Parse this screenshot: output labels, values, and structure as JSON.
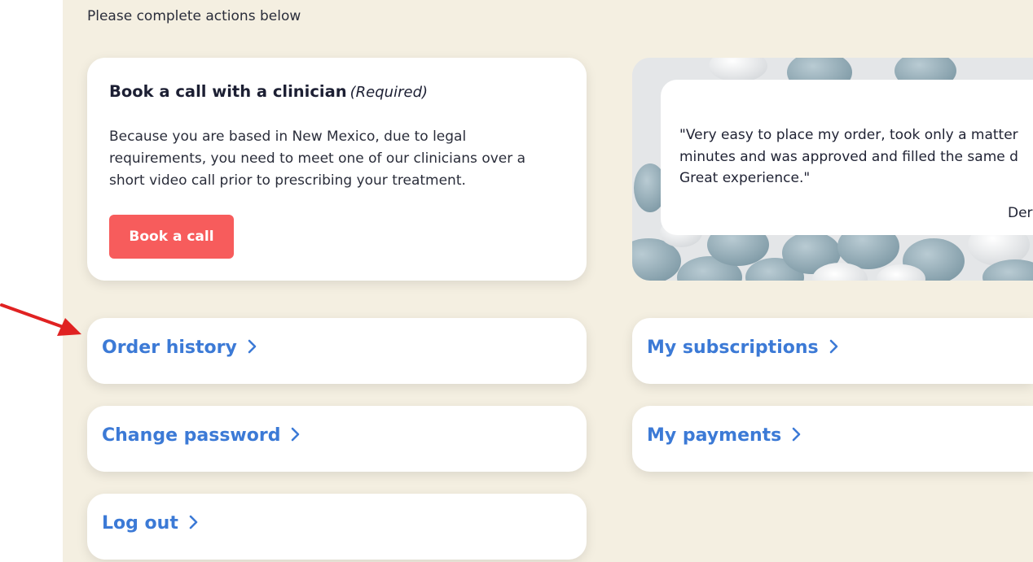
{
  "intro": "Please complete actions below",
  "book_call": {
    "title": "Book a call with a clinician",
    "required": "(Required)",
    "body": "Because you are based in New Mexico, due to legal requirements, you need to meet one of our clinicians over a short video call prior to prescribing your treatment.",
    "button": "Book a call"
  },
  "review": {
    "quote": "\"Very easy to place my order, took only a matter\nminutes and was approved and filled the same d\nGreat experience.\"",
    "author": "Der"
  },
  "links": {
    "order_history": "Order history",
    "my_subscriptions": "My subscriptions",
    "change_password": "Change password",
    "my_payments": "My payments",
    "log_out": "Log out"
  },
  "colors": {
    "background": "#f4efe1",
    "card": "#ffffff",
    "accent_button": "#f75c5c",
    "link": "#3c7ad6",
    "annotation_arrow": "#e02222"
  },
  "icons": {
    "link_chevron": "chevron-right-icon",
    "annotation": "red-arrow-icon"
  }
}
